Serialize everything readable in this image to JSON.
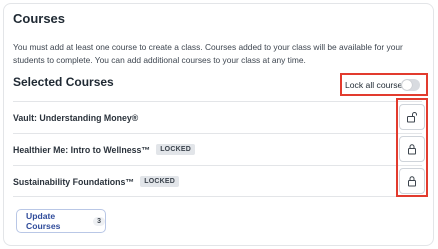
{
  "header": {
    "title": "Courses",
    "description": "You must add at least one course to create a class. Courses added to your class will be available for your students to complete. You can add additional courses to your class at any time."
  },
  "selected": {
    "title": "Selected Courses",
    "lock_all_label": "Lock all courses",
    "lock_all_on": false
  },
  "courses": [
    {
      "name": "Vault: Understanding Money®",
      "badge": "",
      "icon": "unlocked-padlock-icon"
    },
    {
      "name": "Healthier Me: Intro to Wellness™",
      "badge": "LOCKED",
      "icon": "locked-padlock-icon"
    },
    {
      "name": "Sustainability Foundations™",
      "badge": "LOCKED",
      "icon": "locked-padlock-icon"
    }
  ],
  "footer": {
    "update_label": "Update Courses",
    "count": "3"
  },
  "colors": {
    "highlight": "#e23b2e",
    "accent": "#2f4b9a"
  }
}
